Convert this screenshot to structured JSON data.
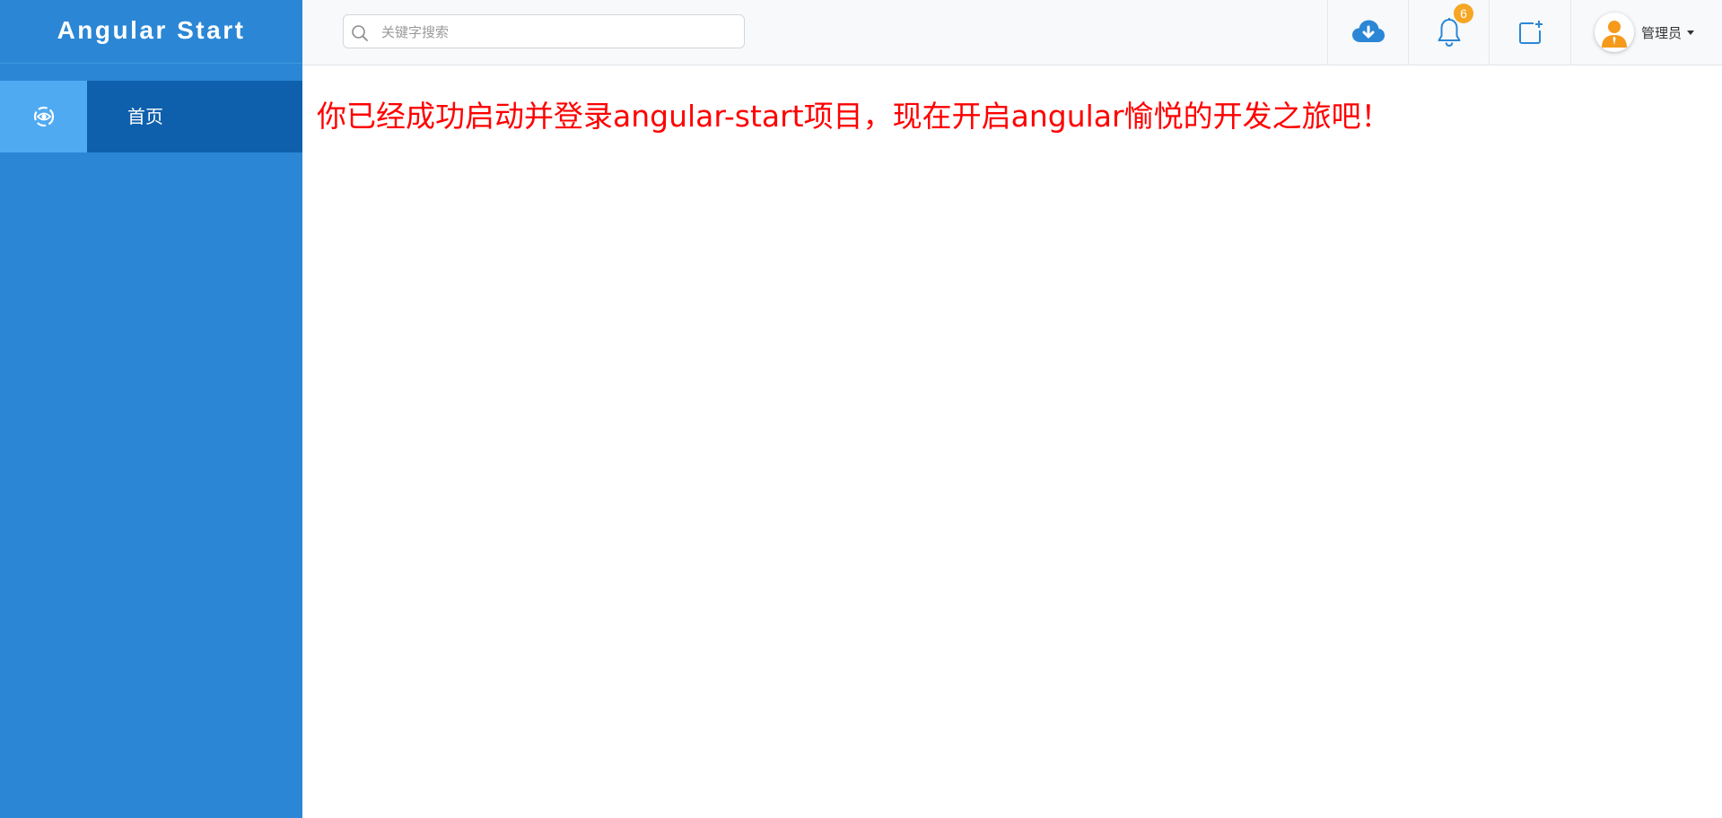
{
  "sidebar": {
    "brand": "Angular Start",
    "items": [
      {
        "label": "首页",
        "icon": "eye-icon",
        "active": true
      }
    ]
  },
  "header": {
    "search": {
      "placeholder": "关键字搜索",
      "value": ""
    },
    "actions": [
      {
        "icon": "cloud-download-icon"
      },
      {
        "icon": "bell-icon",
        "badge": "6"
      },
      {
        "icon": "new-window-icon"
      }
    ],
    "user": {
      "name": "管理员",
      "avatar": "user-avatar-icon"
    }
  },
  "content": {
    "message": "你已经成功启动并登录angular-start项目，现在开启angular愉悦的开发之旅吧！"
  },
  "colors": {
    "sidebar_bg": "#2b87d5",
    "nav_active_bg": "#0f60ac",
    "nav_icon_bg": "#4faaf2",
    "accent": "#2b87d5",
    "badge": "#f5a623",
    "message": "#ff0000"
  }
}
